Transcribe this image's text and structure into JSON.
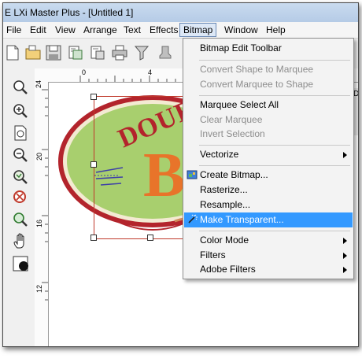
{
  "window": {
    "title": "E LXi Master Plus - [Untitled 1]"
  },
  "menubar": {
    "items": [
      "File",
      "Edit",
      "View",
      "Arrange",
      "Text",
      "Effects",
      "Bitmap",
      "Window",
      "Help"
    ],
    "active": "Bitmap"
  },
  "toolbar": {
    "icons": [
      "new-document-icon",
      "open-icon",
      "save-icon",
      "import-icon",
      "export-icon",
      "print-icon",
      "plot-icon",
      "output-icon"
    ]
  },
  "ruler": {
    "horizontal_labels": [
      "0",
      "4"
    ],
    "vertical_labels": [
      "24",
      "20",
      "16",
      "12"
    ]
  },
  "left_tools": [
    "zoom-icon",
    "zoom-in-icon",
    "zoom-page-icon",
    "zoom-out-icon",
    "zoom-selection-icon",
    "zoom-all-icon",
    "zoom-previous-icon",
    "pan-hand-icon",
    "fill-icon"
  ],
  "canvas": {
    "artwork_text_partial": "DOUB",
    "artwork_letter": "B"
  },
  "right_panel": {
    "tab_label": "De"
  },
  "bitmap_menu": {
    "items": [
      {
        "label": "Bitmap Edit Toolbar",
        "enabled": true,
        "submenu": false,
        "icon": ""
      },
      {
        "label": "Convert Shape to Marquee",
        "enabled": false,
        "submenu": false,
        "icon": ""
      },
      {
        "label": "Convert Marquee to Shape",
        "enabled": false,
        "submenu": false,
        "icon": ""
      },
      {
        "label": "Marquee Select All",
        "enabled": true,
        "submenu": false,
        "icon": ""
      },
      {
        "label": "Clear Marquee",
        "enabled": false,
        "submenu": false,
        "icon": ""
      },
      {
        "label": "Invert Selection",
        "enabled": false,
        "submenu": false,
        "icon": ""
      },
      {
        "label": "Vectorize",
        "enabled": true,
        "submenu": true,
        "icon": ""
      },
      {
        "label": "Create Bitmap...",
        "enabled": true,
        "submenu": false,
        "icon": "create-bitmap-icon"
      },
      {
        "label": "Rasterize...",
        "enabled": true,
        "submenu": false,
        "icon": ""
      },
      {
        "label": "Resample...",
        "enabled": true,
        "submenu": false,
        "icon": ""
      },
      {
        "label": "Make Transparent...",
        "enabled": true,
        "submenu": false,
        "icon": "magic-wand-icon",
        "highlighted": true
      },
      {
        "label": "Color Mode",
        "enabled": true,
        "submenu": true,
        "icon": ""
      },
      {
        "label": "Filters",
        "enabled": true,
        "submenu": true,
        "icon": ""
      },
      {
        "label": "Adobe Filters",
        "enabled": true,
        "submenu": true,
        "icon": ""
      }
    ]
  },
  "colors": {
    "highlight": "#3399ff",
    "disabled_text": "#8d8d8d",
    "artwork_green": "#a8cf6e",
    "artwork_red": "#b3242c",
    "artwork_orange": "#e8742a"
  }
}
